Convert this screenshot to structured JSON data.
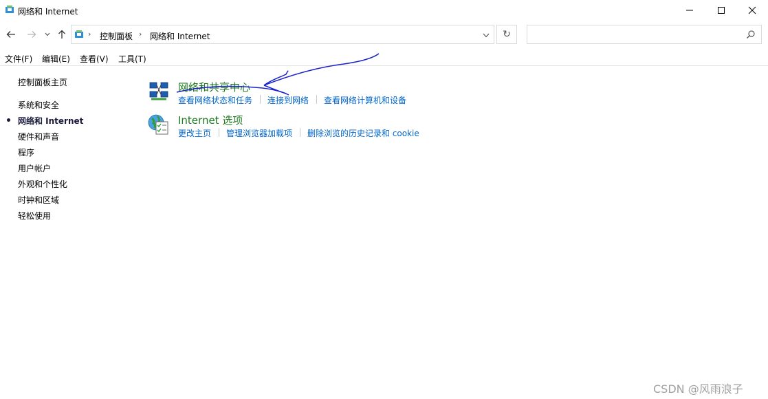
{
  "window": {
    "title": "网络和 Internet",
    "controls": {
      "minimize": "─",
      "maximize": "☐",
      "close": "✕"
    }
  },
  "nav": {
    "back": "←",
    "forward": "→",
    "recent": "⌄",
    "up": "↑",
    "breadcrumbs": [
      "控制面板",
      "网络和 Internet"
    ],
    "breadcrumb_separator": "›",
    "address_dropdown": "⌄",
    "refresh": "↻",
    "search": {
      "value": "",
      "placeholder": ""
    }
  },
  "menu": [
    "文件(F)",
    "编辑(E)",
    "查看(V)",
    "工具(T)"
  ],
  "sidebar": {
    "items": [
      {
        "label": "控制面板主页",
        "current": false
      },
      {
        "label": "系统和安全",
        "current": false
      },
      {
        "label": "网络和 Internet",
        "current": true
      },
      {
        "label": "硬件和声音",
        "current": false
      },
      {
        "label": "程序",
        "current": false
      },
      {
        "label": "用户帐户",
        "current": false
      },
      {
        "label": "外观和个性化",
        "current": false
      },
      {
        "label": "时钟和区域",
        "current": false
      },
      {
        "label": "轻松使用",
        "current": false
      }
    ]
  },
  "categories": [
    {
      "title": "网络和共享中心",
      "icon": "network-sharing-center-icon",
      "tasks": [
        "查看网络状态和任务",
        "连接到网络",
        "查看网络计算机和设备"
      ]
    },
    {
      "title": "Internet 选项",
      "icon": "internet-options-icon",
      "tasks": [
        "更改主页",
        "管理浏览器加载项",
        "删除浏览的历史记录和 cookie"
      ]
    }
  ],
  "watermark": "CSDN @风雨浪子",
  "colors": {
    "category_title": "#1e7a1e",
    "task_link": "#0066cc",
    "annotation_ink": "#1a22cc"
  }
}
